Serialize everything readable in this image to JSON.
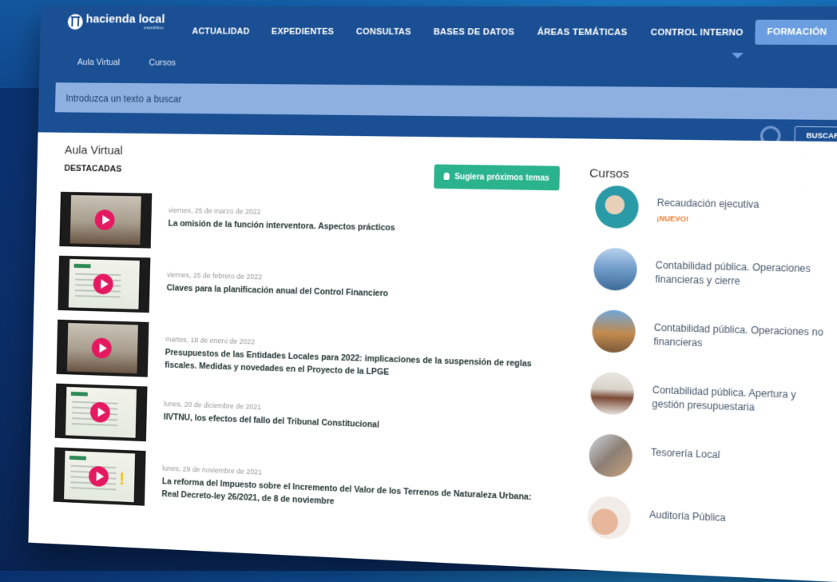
{
  "brand": {
    "name": "hacienda local",
    "sub": "espublico."
  },
  "nav": {
    "items": [
      "ACTUALIDAD",
      "EXPEDIENTES",
      "CONSULTAS",
      "BASES DE DATOS",
      "ÁREAS TEMÁTICAS",
      "CONTROL INTERNO",
      "FORMACIÓN"
    ],
    "active": "FORMACIÓN"
  },
  "subnav": {
    "items": [
      "Aula Virtual",
      "Cursos"
    ]
  },
  "search": {
    "placeholder": "Introduzca un texto a buscar",
    "button_label": "BUSCAR"
  },
  "main": {
    "title": "Aula Virtual",
    "subtitle": "DESTACADAS",
    "suggest_label": "Sugiera próximos temas",
    "videos": [
      {
        "date": "viernes, 25 de marzo de 2022",
        "title": "La omisión de la función interventora. Aspectos prácticos"
      },
      {
        "date": "viernes, 25 de febrero de 2022",
        "title": "Claves para la planificación anual del Control Financiero"
      },
      {
        "date": "martes, 18 de enero de 2022",
        "title": "Presupuestos de las Entidades Locales para 2022: implicaciones de la suspensión de reglas fiscales. Medidas y novedades en el Proyecto de la LPGE"
      },
      {
        "date": "lunes, 20 de diciembre de 2021",
        "title": "IIVTNU, los efectos del fallo del Tribunal Constitucional"
      },
      {
        "date": "lunes, 29 de noviembre de 2021",
        "title": "La reforma del Impuesto sobre el Incremento del Valor de los Terrenos de Naturaleza Urbana: Real Decreto-ley 26/2021, de 8 de noviembre"
      }
    ]
  },
  "courses": {
    "title": "Cursos",
    "items": [
      {
        "name": "Recaudación ejecutiva",
        "badge": "¡NUEVO!"
      },
      {
        "name": "Contabilidad pública. Operaciones financieras y cierre"
      },
      {
        "name": "Contabilidad pública. Operaciones no financieras"
      },
      {
        "name": "Contabilidad pública. Apertura y gestión presupuestaria"
      },
      {
        "name": "Tesorería Local"
      },
      {
        "name": "Auditoría Pública"
      }
    ]
  },
  "colors": {
    "nav_bg": "#1a4f94",
    "active_tab": "#6a9ee0",
    "search_bar": "#8db0e0",
    "suggest_btn": "#2bb38e",
    "play": "#e4195f",
    "badge": "#f07a2a"
  }
}
